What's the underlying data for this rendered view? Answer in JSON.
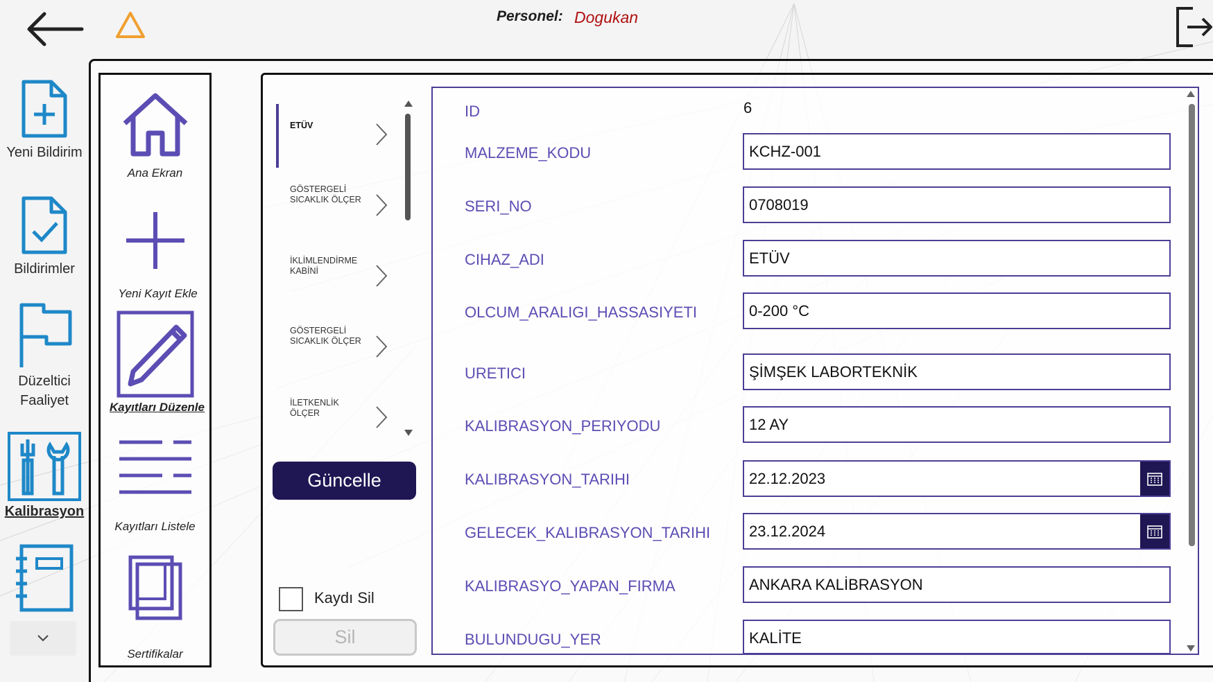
{
  "header": {
    "personel_label": "Personel:",
    "personel_name": "Dogukan"
  },
  "colors": {
    "accent": "#4b3f96",
    "primary_button": "#1f1654",
    "rail_icon": "#1e88c8",
    "user_name": "#b01010",
    "warning": "#f0a030"
  },
  "rail": {
    "items": [
      {
        "label": "Yeni Bildirim",
        "icon": "file-add-icon"
      },
      {
        "label": "Bildirimler",
        "icon": "file-check-icon"
      },
      {
        "label": "Düzeltici Faaliyet",
        "icon": "flag-icon"
      },
      {
        "label": "Kalibrasyon",
        "icon": "tools-icon"
      },
      {
        "label": "",
        "icon": "notebook-icon"
      }
    ]
  },
  "nav": {
    "items": [
      {
        "label": "Ana Ekran",
        "icon": "home-icon"
      },
      {
        "label": "Yeni Kayıt Ekle",
        "icon": "plus-icon"
      },
      {
        "label": "Kayıtları Düzenle",
        "icon": "edit-icon"
      },
      {
        "label": "Kayıtları Listele",
        "icon": "list-icon"
      },
      {
        "label": "Sertifikalar",
        "icon": "copy-icon"
      }
    ]
  },
  "gallery": {
    "items": [
      {
        "title": "ETÜV"
      },
      {
        "title": "GÖSTERGELİ SICAKLIK ÖLÇER"
      },
      {
        "title": "İKLİMLENDİRME KABİNİ"
      },
      {
        "title": "GÖSTERGELİ SICAKLIK ÖLÇER"
      },
      {
        "title": "İLETKENLİK ÖLÇER"
      }
    ]
  },
  "actions": {
    "update_label": "Güncelle",
    "delete_checkbox_label": "Kaydı Sil",
    "delete_label": "Sil"
  },
  "form": {
    "id_label": "ID",
    "id_value": "6",
    "fields": [
      {
        "label": "MALZEME_KODU",
        "value": "KCHZ-001"
      },
      {
        "label": "SERI_NO",
        "value": "0708019"
      },
      {
        "label": "CIHAZ_ADI",
        "value": "ETÜV"
      },
      {
        "label": "OLCUM_ARALIGI_HASSASIYETI",
        "value": "0-200 °C"
      },
      {
        "label": "URETICI",
        "value": "ŞİMŞEK LABORTEKNİK"
      },
      {
        "label": "KALIBRASYON_PERIYODU",
        "value": "12 AY"
      },
      {
        "label": "KALIBRASYON_TARIHI",
        "value": "22.12.2023"
      },
      {
        "label": "GELECEK_KALIBRASYON_TARIHI",
        "value": "23.12.2024"
      },
      {
        "label": "KALIBRASYO_YAPAN_FIRMA",
        "value": "ANKARA KALİBRASYON"
      },
      {
        "label": "BULUNDUGU_YER",
        "value": "KALİTE"
      }
    ]
  }
}
